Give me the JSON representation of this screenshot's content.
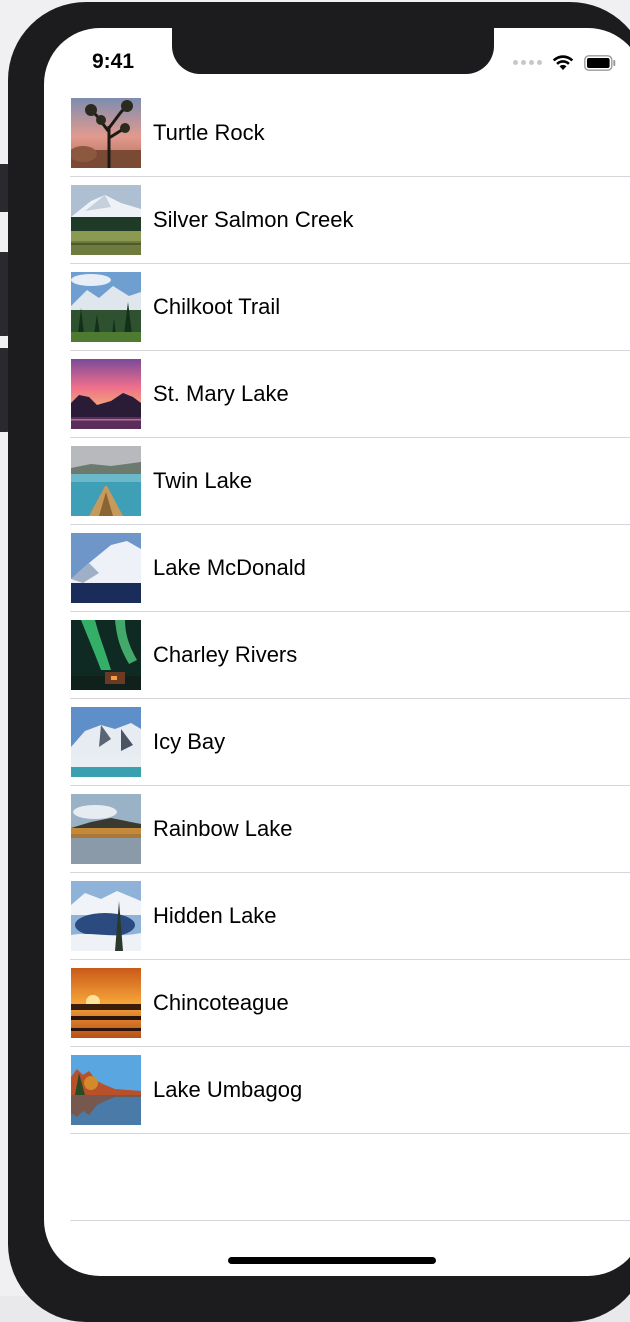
{
  "status_bar": {
    "time": "9:41"
  },
  "landmarks": [
    {
      "name": "Turtle Rock",
      "image": "turtle-rock"
    },
    {
      "name": "Silver Salmon Creek",
      "image": "silver-salmon-creek"
    },
    {
      "name": "Chilkoot Trail",
      "image": "chilkoot-trail"
    },
    {
      "name": "St. Mary Lake",
      "image": "st-mary-lake"
    },
    {
      "name": "Twin Lake",
      "image": "twin-lake"
    },
    {
      "name": "Lake McDonald",
      "image": "lake-mcdonald"
    },
    {
      "name": "Charley Rivers",
      "image": "charley-rivers"
    },
    {
      "name": "Icy Bay",
      "image": "icy-bay"
    },
    {
      "name": "Rainbow Lake",
      "image": "rainbow-lake"
    },
    {
      "name": "Hidden Lake",
      "image": "hidden-lake"
    },
    {
      "name": "Chincoteague",
      "image": "chincoteague"
    },
    {
      "name": "Lake Umbagog",
      "image": "lake-umbagog"
    }
  ]
}
